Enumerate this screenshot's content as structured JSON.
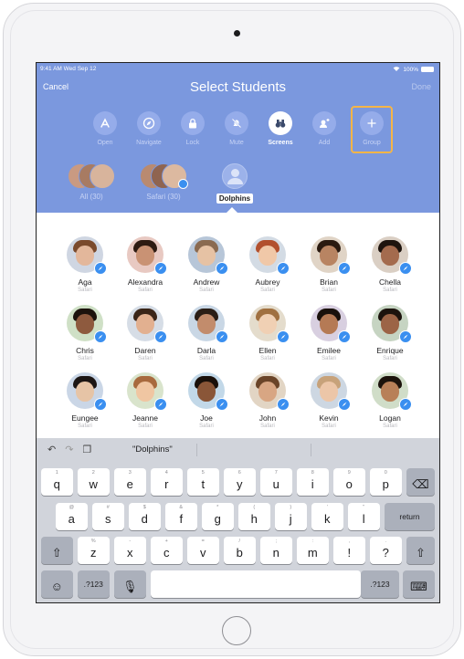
{
  "status": {
    "time": "9:41 AM  Wed Sep 12",
    "battery": "100%"
  },
  "nav": {
    "cancel": "Cancel",
    "title": "Select Students",
    "done": "Done"
  },
  "toolbar": [
    {
      "id": "open",
      "label": "Open",
      "icon": "app-store-icon"
    },
    {
      "id": "navigate",
      "label": "Navigate",
      "icon": "compass-icon"
    },
    {
      "id": "lock",
      "label": "Lock",
      "icon": "lock-icon"
    },
    {
      "id": "mute",
      "label": "Mute",
      "icon": "mute-bell-icon"
    },
    {
      "id": "screens",
      "label": "Screens",
      "icon": "binoculars-icon"
    },
    {
      "id": "add",
      "label": "Add",
      "icon": "add-person-icon"
    },
    {
      "id": "group",
      "label": "Group",
      "icon": "plus-icon"
    }
  ],
  "filters": [
    {
      "label": "All (30)"
    },
    {
      "label": "Safari (30)"
    },
    {
      "label": "Dolphins"
    }
  ],
  "students": [
    {
      "name": "Aga",
      "app": "Safari"
    },
    {
      "name": "Alexandra",
      "app": "Safari"
    },
    {
      "name": "Andrew",
      "app": "Safari"
    },
    {
      "name": "Aubrey",
      "app": "Safari"
    },
    {
      "name": "Brian",
      "app": "Safari"
    },
    {
      "name": "Chella",
      "app": "Safari"
    },
    {
      "name": "Chris",
      "app": "Safari"
    },
    {
      "name": "Daren",
      "app": "Safari"
    },
    {
      "name": "Darla",
      "app": "Safari"
    },
    {
      "name": "Ellen",
      "app": "Safari"
    },
    {
      "name": "Emilee",
      "app": "Safari"
    },
    {
      "name": "Enrique",
      "app": "Safari"
    },
    {
      "name": "Eungee",
      "app": "Safari"
    },
    {
      "name": "Jeanne",
      "app": "Safari"
    },
    {
      "name": "Joe",
      "app": "Safari"
    },
    {
      "name": "John",
      "app": "Safari"
    },
    {
      "name": "Kevin",
      "app": "Safari"
    },
    {
      "name": "Logan",
      "app": "Safari"
    }
  ],
  "keyboard": {
    "prediction": "\"Dolphins\"",
    "row1": [
      {
        "k": "q",
        "s": "1"
      },
      {
        "k": "w",
        "s": "2"
      },
      {
        "k": "e",
        "s": "3"
      },
      {
        "k": "r",
        "s": "4"
      },
      {
        "k": "t",
        "s": "5"
      },
      {
        "k": "y",
        "s": "6"
      },
      {
        "k": "u",
        "s": "7"
      },
      {
        "k": "i",
        "s": "8"
      },
      {
        "k": "o",
        "s": "9"
      },
      {
        "k": "p",
        "s": "0"
      }
    ],
    "row2": [
      {
        "k": "a",
        "s": "@"
      },
      {
        "k": "s",
        "s": "#"
      },
      {
        "k": "d",
        "s": "$"
      },
      {
        "k": "f",
        "s": "&"
      },
      {
        "k": "g",
        "s": "*"
      },
      {
        "k": "h",
        "s": "("
      },
      {
        "k": "j",
        "s": ")"
      },
      {
        "k": "k",
        "s": "'"
      },
      {
        "k": "l",
        "s": "\""
      }
    ],
    "row3": [
      {
        "k": "z",
        "s": "%"
      },
      {
        "k": "x",
        "s": "-"
      },
      {
        "k": "c",
        "s": "+"
      },
      {
        "k": "v",
        "s": "="
      },
      {
        "k": "b",
        "s": "/"
      },
      {
        "k": "n",
        "s": ";"
      },
      {
        "k": "m",
        "s": ":"
      },
      {
        "k": "!",
        "s": ","
      },
      {
        "k": "?",
        "s": "."
      }
    ],
    "return": "return",
    "numbers": ".?123"
  },
  "colors": {
    "header": "#7b98de",
    "highlight": "#f5b547",
    "safari_badge": "#3a8ff0"
  }
}
